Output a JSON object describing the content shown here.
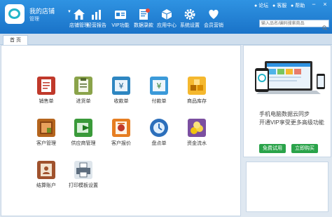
{
  "header": {
    "shop_name": "我的店铺",
    "shop_sub": "管理",
    "nav": [
      {
        "label": "店铺管理",
        "icon": "home-icon"
      },
      {
        "label": "经营报告",
        "icon": "bar-chart-icon"
      },
      {
        "label": "VIP功能",
        "icon": "vip-card-icon"
      },
      {
        "label": "数据录款",
        "icon": "document-icon"
      },
      {
        "label": "应用中心",
        "icon": "cube-icon"
      },
      {
        "label": "系统设置",
        "icon": "gear-icon"
      },
      {
        "label": "会员营销",
        "icon": "heart-icon"
      }
    ],
    "links": [
      {
        "label": "论坛",
        "icon": "forum-icon"
      },
      {
        "label": "客服",
        "icon": "service-icon"
      },
      {
        "label": "帮助",
        "icon": "help-icon"
      }
    ],
    "search": {
      "placeholder": "输入品名/编码搜索商品"
    },
    "colors": {
      "top": "#2f93e2",
      "bottom": "#1a73c8"
    }
  },
  "tabs": [
    {
      "label": "首 页"
    }
  ],
  "functions": [
    {
      "label": "销售单",
      "icon": "sales-order-icon",
      "color": "#c0392b"
    },
    {
      "label": "进货单",
      "icon": "purchase-order-icon",
      "color": "#6b8e23"
    },
    {
      "label": "收款单",
      "icon": "receipt-icon",
      "color": "#2e86c1"
    },
    {
      "label": "付款单",
      "icon": "payment-icon",
      "color": "#2e86c1"
    },
    {
      "label": "商品库存",
      "icon": "inventory-icon",
      "color": "#e6a23c"
    },
    {
      "label": "客户管理",
      "icon": "customer-icon",
      "color": "#b5651d"
    },
    {
      "label": "供应商管理",
      "icon": "supplier-icon",
      "color": "#3a9a3a"
    },
    {
      "label": "客户报价",
      "icon": "quote-icon",
      "color": "#d35400"
    },
    {
      "label": "盘点单",
      "icon": "stocktake-icon",
      "color": "#2c6fbb"
    },
    {
      "label": "资金流水",
      "icon": "cashflow-icon",
      "color": "#d4a017"
    },
    {
      "label": "结算账户",
      "icon": "account-icon",
      "color": "#a0522d"
    },
    {
      "label": "打印模板设置",
      "icon": "printer-icon",
      "color": "#5d6d7e"
    }
  ],
  "promo": {
    "line1": "手机电脑数据云同步",
    "line2": "开通VIP享受更多高级功能",
    "trial_button": "免费试用",
    "buy_button": "立即购买"
  }
}
